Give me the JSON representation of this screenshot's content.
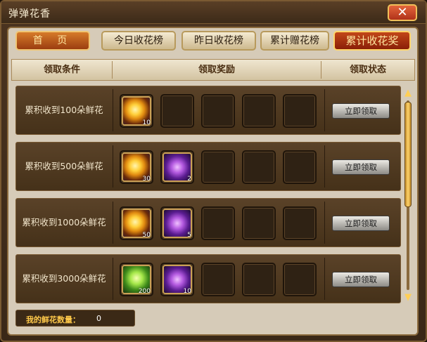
{
  "window": {
    "title": "弹弹花香",
    "close_icon": "close-icon"
  },
  "tabs": [
    "首 页",
    "今日收花榜",
    "昨日收花榜",
    "累计赠花榜",
    "累计收花奖"
  ],
  "active_tab": "累计收花奖",
  "header": {
    "condition": "领取条件",
    "reward": "领取奖励",
    "status": "领取状态"
  },
  "rows": [
    {
      "condition": "累积收到100朵鲜花",
      "rewards": [
        {
          "icon": "gold-orb-icon",
          "count": "10"
        }
      ],
      "button": "立即领取"
    },
    {
      "condition": "累积收到500朵鲜花",
      "rewards": [
        {
          "icon": "gold-orb-icon",
          "count": "30"
        },
        {
          "icon": "purple-crystal-icon",
          "count": "2"
        }
      ],
      "button": "立即领取"
    },
    {
      "condition": "累积收到1000朵鲜花",
      "rewards": [
        {
          "icon": "gold-orb-icon",
          "count": "50"
        },
        {
          "icon": "purple-crystal-icon",
          "count": "5"
        }
      ],
      "button": "立即领取"
    },
    {
      "condition": "累积收到3000朵鲜花",
      "rewards": [
        {
          "icon": "green-star-icon",
          "count": "200"
        },
        {
          "icon": "purple-crystal-icon",
          "count": "10"
        }
      ],
      "button": "立即领取"
    }
  ],
  "footer": {
    "label": "我的鲜花数量：",
    "value": "0"
  }
}
